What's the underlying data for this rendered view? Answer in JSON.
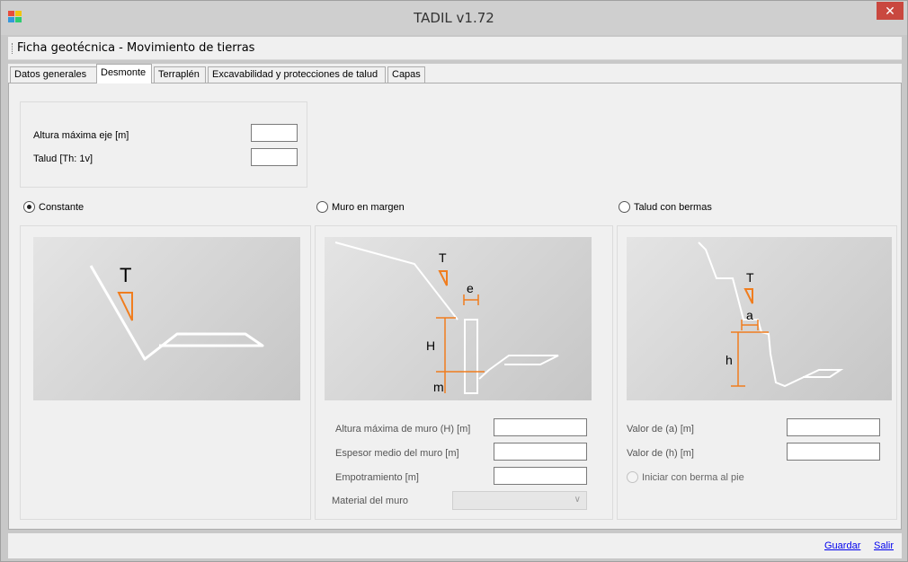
{
  "window": {
    "title": "TADIL v1.72",
    "close_glyph": "✕",
    "app_icon": "app-icon"
  },
  "menubar": {
    "items": [
      {
        "label": "Ficha geotécnica - Movimiento de tierras"
      }
    ]
  },
  "tabs": [
    {
      "label": "Datos generales",
      "active": false
    },
    {
      "label": "Desmonte",
      "active": true
    },
    {
      "label": "Terraplén",
      "active": false
    },
    {
      "label": "Excavabilidad y protecciones de talud",
      "active": false
    },
    {
      "label": "Capas",
      "active": false
    }
  ],
  "general": {
    "altura_label": "Altura máxima eje [m]",
    "altura_value": "",
    "talud_label": "Talud [Th: 1v]",
    "talud_value": ""
  },
  "options": {
    "constante": {
      "label": "Constante",
      "checked": true
    },
    "muro": {
      "label": "Muro en margen",
      "checked": false
    },
    "bermas": {
      "label": "Talud con bermas",
      "checked": false
    }
  },
  "diagrams": {
    "constante": {
      "labels": [
        "T"
      ]
    },
    "muro": {
      "labels": [
        "T",
        "e",
        "H",
        "m"
      ]
    },
    "bermas": {
      "labels": [
        "T",
        "a",
        "h"
      ]
    }
  },
  "muro_fields": {
    "altura_label": "Altura máxima de muro (H) [m]",
    "altura_value": "",
    "espesor_label": "Espesor medio del muro [m]",
    "espesor_value": "",
    "empotramiento_label": "Empotramiento [m]",
    "empotramiento_value": "",
    "material_label": "Material del muro",
    "material_value": ""
  },
  "bermas_fields": {
    "a_label": "Valor de (a) [m]",
    "a_value": "",
    "h_label": "Valor de (h) [m]",
    "h_value": "",
    "iniciar_label": "Iniciar con berma al pie",
    "iniciar_checked": false
  },
  "footer": {
    "guardar": "Guardar",
    "salir": "Salir"
  },
  "colors": {
    "accent_orange": "#f07d1e",
    "link_blue": "#0000ee",
    "close_red": "#c9483f"
  }
}
